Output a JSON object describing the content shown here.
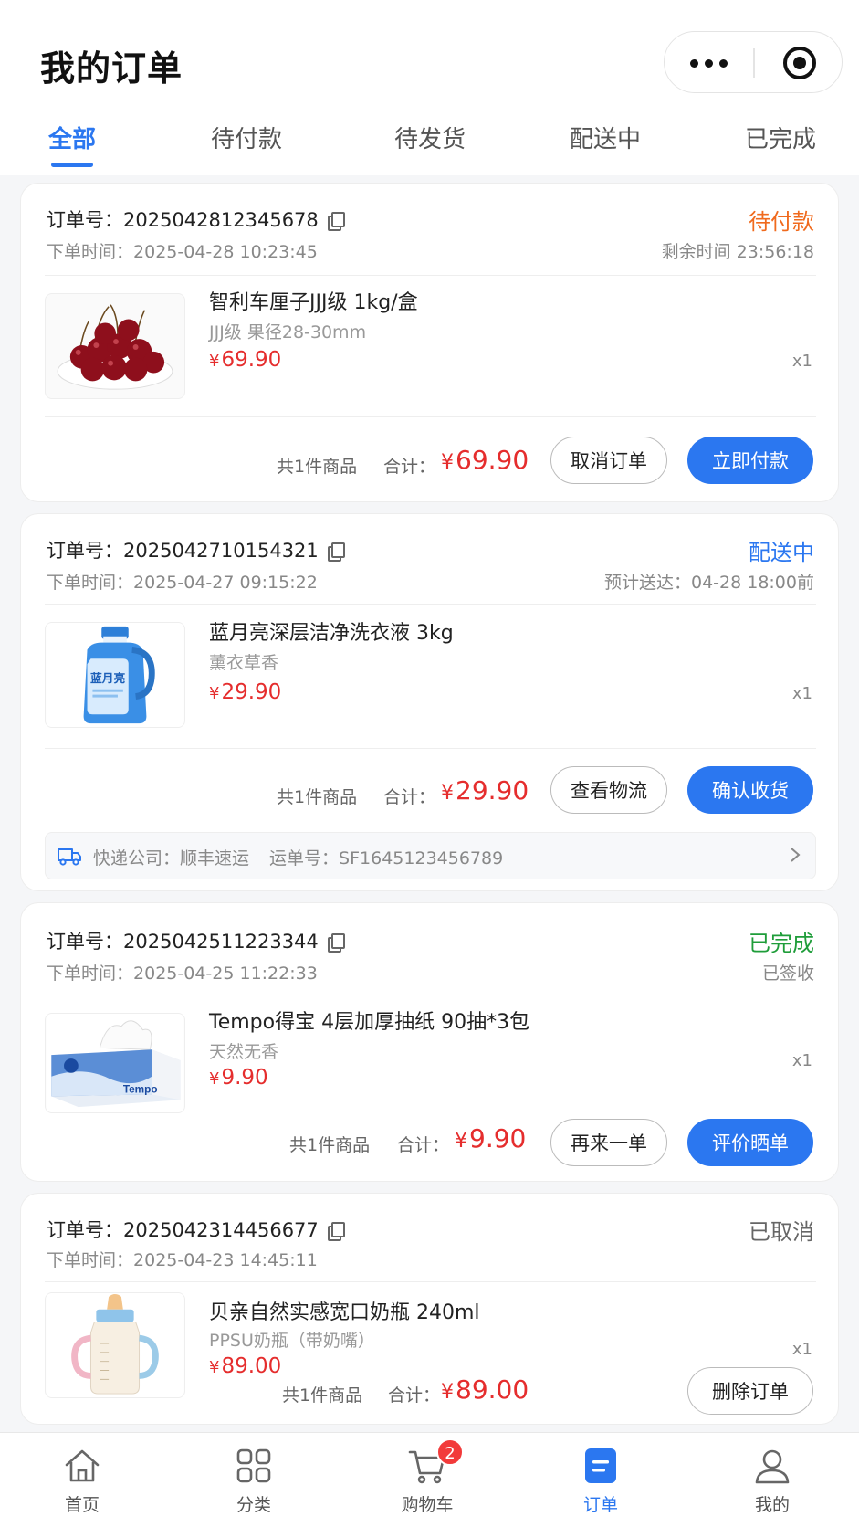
{
  "header": {
    "title": "我的订单"
  },
  "tabs": [
    "全部",
    "待付款",
    "待发货",
    "配送中",
    "已完成"
  ],
  "colors": {
    "accent": "#2b77f0",
    "price": "#e52d2d",
    "pending": "#f06a1d",
    "shipping": "#2b77f0",
    "done": "#1f9d3a",
    "cancelled": "#666666"
  },
  "labels": {
    "order_no": "订单号：",
    "order_time": "下单时间：",
    "total": "合计：",
    "yen": "¥",
    "courier": "快递公司：",
    "waybill": "运单号："
  },
  "orders": [
    {
      "no": "2025042812345678",
      "time": "2025-04-28 10:23:45",
      "status": "待付款",
      "status_sub": "剩余时间 23:56:18",
      "product": {
        "name": "智利车厘子JJJ级 1kg/盒",
        "spec": "JJJ级 果径28-30mm",
        "price": "69.90",
        "qty": "x1",
        "image": "cherries"
      },
      "count": "共1件商品",
      "total": "69.90",
      "buttons": [
        "取消订单",
        "立即付款"
      ]
    },
    {
      "no": "2025042710154321",
      "time": "2025-04-27 09:15:22",
      "status": "配送中",
      "status_sub": "预计送达：04-28 18:00前",
      "product": {
        "name": "蓝月亮深层洁净洗衣液 3kg",
        "spec": "薰衣草香",
        "price": "29.90",
        "qty": "x1",
        "image": "detergent-bottle",
        "brand_text": "蓝月亮"
      },
      "count": "共1件商品",
      "total": "29.90",
      "buttons": [
        "查看物流",
        "确认收货"
      ],
      "logistics": {
        "courier": "顺丰速运",
        "waybill": "SF1645123456789"
      }
    },
    {
      "no": "2025042511223344",
      "time": "2025-04-25 11:22:33",
      "status": "已完成",
      "status_sub": "已签收",
      "product": {
        "name": "Tempo得宝 4层加厚抽纸 90抽*3包",
        "spec": "天然无香",
        "price": "9.90",
        "qty": "x1",
        "image": "tissue-box",
        "brand_text": "Tempo"
      },
      "count": "共1件商品",
      "total": "9.90",
      "buttons": [
        "再来一单",
        "评价晒单"
      ]
    },
    {
      "no": "2025042314456677",
      "time": "2025-04-23 14:45:11",
      "status": "已取消",
      "product": {
        "name": "贝亲自然实感宽口奶瓶 240ml",
        "spec": "PPSU奶瓶（带奶嘴）",
        "price": "89.00",
        "qty": "x1",
        "image": "baby-bottle"
      },
      "count": "共1件商品",
      "total": "89.00",
      "buttons": [
        "删除订单"
      ]
    }
  ],
  "bottom_nav": [
    {
      "label": "首页",
      "icon": "home-icon"
    },
    {
      "label": "分类",
      "icon": "category-icon"
    },
    {
      "label": "购物车",
      "icon": "cart-icon",
      "badge": "2"
    },
    {
      "label": "订单",
      "icon": "order-icon",
      "active": true
    },
    {
      "label": "我的",
      "icon": "profile-icon"
    }
  ]
}
